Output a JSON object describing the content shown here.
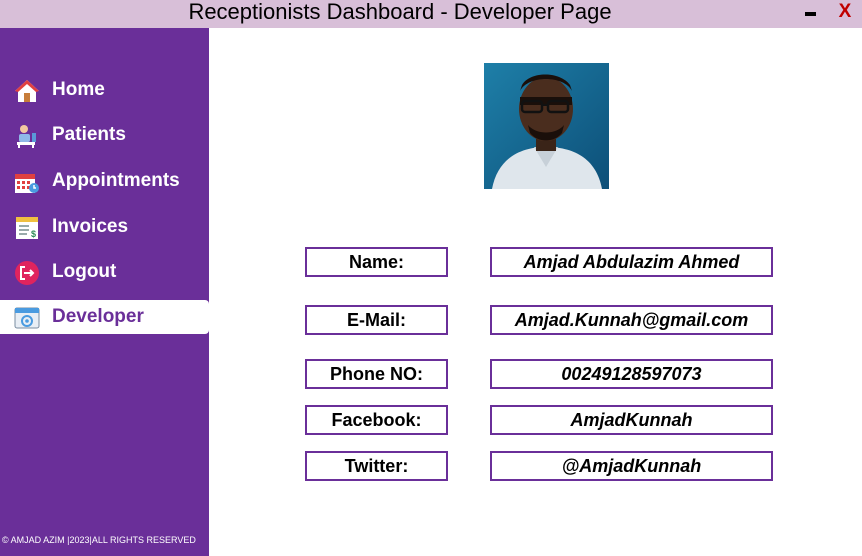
{
  "window": {
    "title": "Receptionists Dashboard - Developer Page",
    "close_label": "X"
  },
  "sidebar": {
    "items": [
      {
        "label": "Home",
        "icon": "home-icon"
      },
      {
        "label": "Patients",
        "icon": "patients-icon"
      },
      {
        "label": "Appointments",
        "icon": "calendar-icon"
      },
      {
        "label": "Invoices",
        "icon": "invoice-icon"
      },
      {
        "label": "Logout",
        "icon": "logout-icon"
      },
      {
        "label": "Developer",
        "icon": "developer-icon",
        "active": true
      }
    ],
    "footer": "© AMJAD AZIM |2023|ALL RIGHTS RESERVED"
  },
  "developer": {
    "fields": [
      {
        "label": "Name:",
        "value": "Amjad Abdulazim Ahmed"
      },
      {
        "label": "E-Mail:",
        "value": "Amjad.Kunnah@gmail.com"
      },
      {
        "label": "Phone NO:",
        "value": "00249128597073"
      },
      {
        "label": "Facebook:",
        "value": "AmjadKunnah"
      },
      {
        "label": "Twitter:",
        "value": "@AmjadKunnah"
      }
    ]
  },
  "colors": {
    "sidebar": "#6a2f99",
    "titlebar": "#d8bfd8",
    "close": "#c00000"
  }
}
